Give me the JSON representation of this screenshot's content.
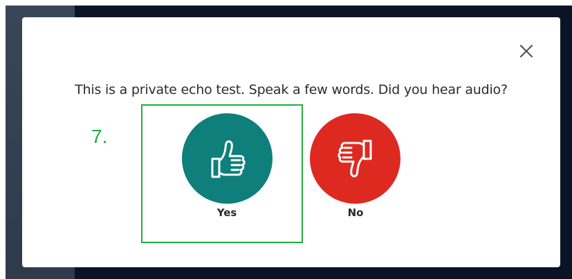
{
  "dialog": {
    "prompt": "This is a private echo test. Speak a few words. Did you hear audio?",
    "close_icon": "close-icon",
    "yes_button": {
      "label": "Yes",
      "icon": "thumbs-up-icon",
      "color": "#0e7f7b"
    },
    "no_button": {
      "label": "No",
      "icon": "thumbs-down-icon",
      "color": "#de2921"
    }
  },
  "annotation": {
    "step_label": "7.",
    "highlight_color": "#1fae3a"
  }
}
